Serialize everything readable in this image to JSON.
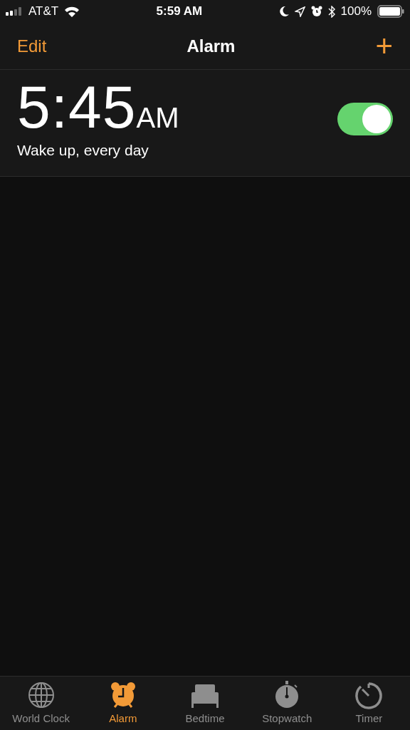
{
  "status_bar": {
    "carrier": "AT&T",
    "time": "5:59 AM",
    "battery": "100%"
  },
  "nav": {
    "edit": "Edit",
    "title": "Alarm",
    "add": "+"
  },
  "alarms": [
    {
      "time": "5:45",
      "period": "AM",
      "label": "Wake up, every day",
      "on": true
    }
  ],
  "tabs": [
    {
      "kind": "globe",
      "label": "World Clock",
      "selected": false
    },
    {
      "kind": "alarm",
      "label": "Alarm",
      "selected": true
    },
    {
      "kind": "bed",
      "label": "Bedtime",
      "selected": false
    },
    {
      "kind": "stopwatch",
      "label": "Stopwatch",
      "selected": false
    },
    {
      "kind": "timer",
      "label": "Timer",
      "selected": false
    }
  ]
}
